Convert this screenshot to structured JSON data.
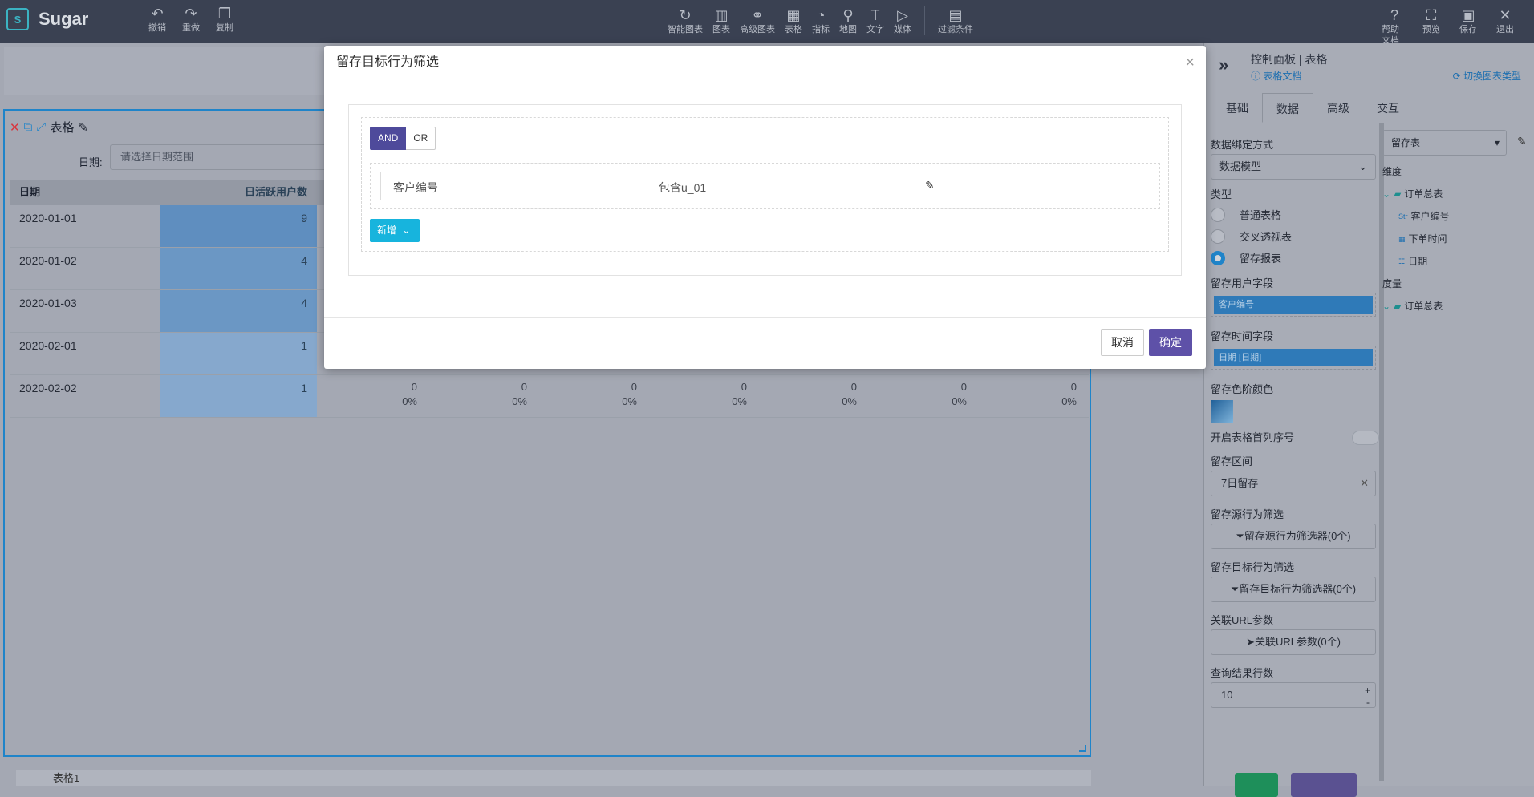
{
  "app": {
    "name": "Sugar"
  },
  "toolbar": {
    "left": [
      {
        "label": "撤销",
        "icon": "undo-icon"
      },
      {
        "label": "重做",
        "icon": "redo-icon"
      },
      {
        "label": "复制",
        "icon": "copy-icon"
      }
    ],
    "center": [
      {
        "label": "智能图表",
        "icon": "smart-chart-icon"
      },
      {
        "label": "图表",
        "icon": "bar-chart-icon"
      },
      {
        "label": "高级图表",
        "icon": "advanced-chart-icon"
      },
      {
        "label": "表格",
        "icon": "table-icon"
      },
      {
        "label": "指标",
        "icon": "gauge-icon"
      },
      {
        "label": "地图",
        "icon": "map-pin-icon"
      },
      {
        "label": "文字",
        "icon": "text-icon"
      },
      {
        "label": "媒体",
        "icon": "media-icon"
      }
    ],
    "filter": {
      "label": "过滤条件",
      "icon": "filter-calendar-icon"
    },
    "right": [
      {
        "label": "帮助文档",
        "icon": "help-icon"
      },
      {
        "label": "预览",
        "icon": "fullscreen-icon"
      },
      {
        "label": "保存",
        "icon": "save-icon"
      },
      {
        "label": "退出",
        "icon": "close-icon"
      }
    ]
  },
  "widget": {
    "title": "表格",
    "date_label": "日期:",
    "date_placeholder": "请选择日期范围",
    "columns": {
      "date": "日期",
      "dau": "日活跃用户数"
    },
    "rows": [
      {
        "date": "2020-01-01",
        "dau": "9",
        "shade": "#5f8ebf",
        "cells": []
      },
      {
        "date": "2020-01-02",
        "dau": "4",
        "shade": "#6b97c4",
        "cells": []
      },
      {
        "date": "2020-01-03",
        "dau": "4",
        "shade": "#6b97c4",
        "cells": []
      },
      {
        "date": "2020-02-01",
        "dau": "1",
        "shade": "#86a8cd",
        "cells": []
      },
      {
        "date": "2020-02-02",
        "dau": "1",
        "shade": "#86a8cd",
        "cells": [
          {
            "v": "0",
            "p": "0%"
          },
          {
            "v": "0",
            "p": "0%"
          },
          {
            "v": "0",
            "p": "0%"
          },
          {
            "v": "0",
            "p": "0%"
          },
          {
            "v": "0",
            "p": "0%"
          },
          {
            "v": "0",
            "p": "0%"
          },
          {
            "v": "0",
            "p": "0%"
          }
        ]
      }
    ],
    "footer_name": "表格1"
  },
  "panel": {
    "title": "控制面板 | 表格",
    "doc_link": "表格文档",
    "switch_type": "切换图表类型",
    "tabs": [
      "基础",
      "数据",
      "高级",
      "交互"
    ],
    "active_tab": "数据",
    "binding_label": "数据绑定方式",
    "binding_value": "数据模型",
    "type_label": "类型",
    "types": [
      "普通表格",
      "交叉透视表",
      "留存报表"
    ],
    "selected_type": "留存报表",
    "user_field_label": "留存用户字段",
    "user_field": "客户编号",
    "time_field_label": "留存时间字段",
    "time_field": "日期 [日期]",
    "color_label": "留存色阶颜色",
    "serial_label": "开启表格首列序号",
    "range_label": "留存区间",
    "range_value": "7日留存",
    "source_filter_label": "留存源行为筛选",
    "source_filter_btn": "留存源行为筛选器(0个)",
    "target_filter_label": "留存目标行为筛选",
    "target_filter_btn": "留存目标行为筛选器(0个)",
    "url_label": "关联URL参数",
    "url_btn": "关联URL参数(0个)",
    "rows_label": "查询结果行数",
    "rows_value": "10",
    "table_select": "留存表",
    "dimension_label": "维度",
    "dimension_root": "订单总表",
    "dimension_fields": [
      "客户编号",
      "下单时间",
      "日期"
    ],
    "measure_label": "度量",
    "measure_root": "订单总表"
  },
  "modal": {
    "title": "留存目标行为筛选",
    "logic": [
      "AND",
      "OR"
    ],
    "active_logic": "AND",
    "condition": {
      "field": "客户编号",
      "value": "包含u_01"
    },
    "add_label": "新增",
    "cancel": "取消",
    "ok": "确定"
  }
}
